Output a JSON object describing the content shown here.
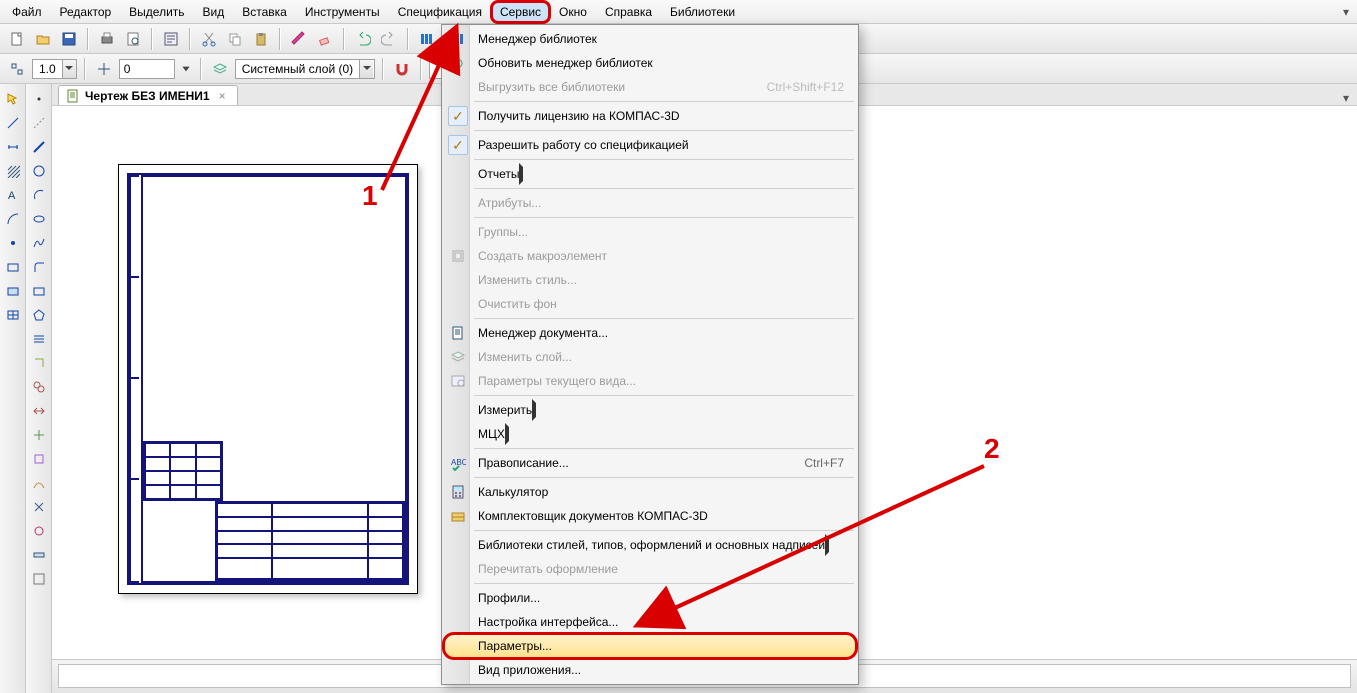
{
  "menubar": {
    "items": [
      {
        "label": "Файл",
        "u": "Ф"
      },
      {
        "label": "Редактор",
        "u": "Р"
      },
      {
        "label": "Выделить",
        "u": "ы"
      },
      {
        "label": "Вид",
        "u": "В"
      },
      {
        "label": "Вставка",
        "u": "а"
      },
      {
        "label": "Инструменты",
        "u": "И"
      },
      {
        "label": "Спецификация",
        "u": "п"
      },
      {
        "label": "Сервис",
        "u": "С"
      },
      {
        "label": "Окно",
        "u": "О"
      },
      {
        "label": "Справка",
        "u": "а"
      },
      {
        "label": "Библиотеки",
        "u": "Б"
      }
    ],
    "active_index": 7
  },
  "toolbar2": {
    "scale_value": "1.0",
    "step_value": "0",
    "layer_label": "Системный слой (0)"
  },
  "doc_tab": {
    "title": "Чертеж БЕЗ ИМЕНИ1"
  },
  "dropdown": {
    "items": [
      {
        "label": "Менеджер библиотек",
        "type": "item",
        "icon": "books"
      },
      {
        "label": "Обновить менеджер библиотек",
        "type": "item",
        "icon": "refresh"
      },
      {
        "label": "Выгрузить все библиотеки",
        "type": "disabled",
        "shortcut": "Ctrl+Shift+F12"
      },
      {
        "type": "divider"
      },
      {
        "label": "Получить лицензию на КОМПАС-3D",
        "type": "check"
      },
      {
        "type": "divider"
      },
      {
        "label": "Разрешить работу со спецификацией",
        "type": "check"
      },
      {
        "type": "divider"
      },
      {
        "label": "Отчеты",
        "type": "submenu"
      },
      {
        "type": "divider"
      },
      {
        "label": "Атрибуты...",
        "type": "disabled"
      },
      {
        "type": "divider"
      },
      {
        "label": "Группы...",
        "type": "disabled"
      },
      {
        "label": "Создать макроэлемент",
        "type": "disabled",
        "icon": "macro"
      },
      {
        "label": "Изменить стиль...",
        "type": "disabled"
      },
      {
        "label": "Очистить фон",
        "type": "disabled"
      },
      {
        "type": "divider"
      },
      {
        "label": "Менеджер документа...",
        "type": "item",
        "icon": "docmgr"
      },
      {
        "label": "Изменить слой...",
        "type": "disabled",
        "icon": "layer"
      },
      {
        "label": "Параметры текущего вида...",
        "type": "disabled",
        "icon": "viewprops"
      },
      {
        "type": "divider"
      },
      {
        "label": "Измерить",
        "type": "submenu"
      },
      {
        "label": "МЦХ",
        "type": "submenu"
      },
      {
        "type": "divider"
      },
      {
        "label": "Правописание...",
        "type": "item",
        "shortcut": "Ctrl+F7",
        "icon": "spell"
      },
      {
        "type": "divider"
      },
      {
        "label": "Калькулятор",
        "type": "item",
        "icon": "calc"
      },
      {
        "label": "Комплектовщик документов КОМПАС-3D",
        "type": "item",
        "icon": "pack"
      },
      {
        "type": "divider"
      },
      {
        "label": "Библиотеки стилей, типов, оформлений и основных надписей",
        "type": "submenu"
      },
      {
        "label": "Перечитать оформление",
        "type": "disabled"
      },
      {
        "type": "divider"
      },
      {
        "label": "Профили...",
        "type": "item"
      },
      {
        "label": "Настройка интерфейса...",
        "type": "item"
      },
      {
        "label": "Параметры...",
        "type": "highlight"
      },
      {
        "label": "Вид приложения...",
        "type": "item"
      }
    ]
  },
  "annotations": {
    "label1": "1",
    "label2": "2"
  }
}
